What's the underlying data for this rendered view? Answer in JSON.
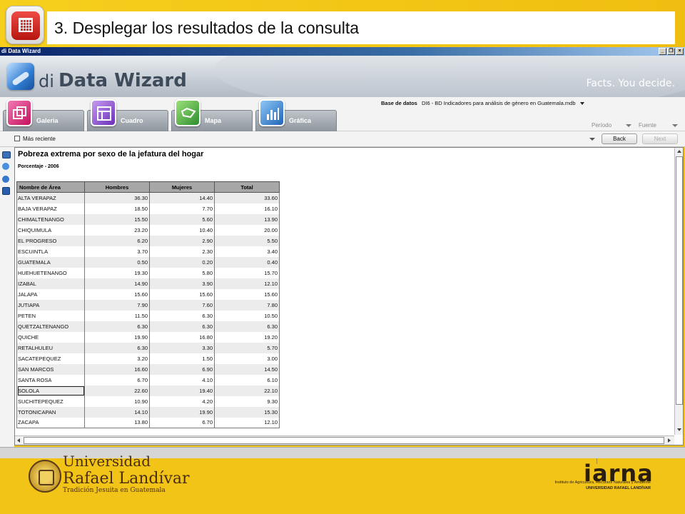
{
  "slide": {
    "title": "3. Desplegar los resultados de la consulta",
    "icon": "table-grid-icon"
  },
  "window": {
    "title": "di Data Wizard",
    "buttons": [
      "_",
      "❐",
      "×"
    ]
  },
  "app": {
    "logo_prefix": "di",
    "logo_name": "Data Wizard",
    "tagline": "Facts. You decide."
  },
  "tabs": [
    {
      "label": "Galeria",
      "icon": "gallery-icon",
      "color": "#d8287a"
    },
    {
      "label": "Cuadro",
      "icon": "table-icon",
      "color": "#7a3fc0"
    },
    {
      "label": "Mapa",
      "icon": "map-icon",
      "color": "#3aa23a"
    },
    {
      "label": "Gráfica",
      "icon": "chart-icon",
      "color": "#2a7fd0"
    }
  ],
  "database": {
    "label": "Base de datos",
    "value": "DI6 - BD Indicadores para análisis de género en Guatemala.mdb"
  },
  "filters": {
    "period": "Período",
    "source": "Fuente"
  },
  "options": {
    "checkbox_label": "Más reciente",
    "back": "Back",
    "next": "Next"
  },
  "report": {
    "title": "Pobreza extrema por sexo de la jefatura del hogar",
    "subtitle": "Porcentaje - 2006",
    "columns": [
      "Nombre de Área",
      "Hombres",
      "Mujeres",
      "Total"
    ],
    "rows": [
      [
        "ALTA VERAPAZ",
        "36.30",
        "14.40",
        "33.60"
      ],
      [
        "BAJA VERAPAZ",
        "18.50",
        "7.70",
        "16.10"
      ],
      [
        "CHIMALTENANGO",
        "15.50",
        "5.60",
        "13.90"
      ],
      [
        "CHIQUIMULA",
        "23.20",
        "10.40",
        "20.00"
      ],
      [
        "EL PROGRESO",
        "6.20",
        "2.90",
        "5.50"
      ],
      [
        "ESCUINTLA",
        "3.70",
        "2.30",
        "3.40"
      ],
      [
        "GUATEMALA",
        "0.50",
        "0.20",
        "0.40"
      ],
      [
        "HUEHUETENANGO",
        "19.30",
        "5.80",
        "15.70"
      ],
      [
        "IZABAL",
        "14.90",
        "3.90",
        "12.10"
      ],
      [
        "JALAPA",
        "15.60",
        "15.60",
        "15.60"
      ],
      [
        "JUTIAPA",
        "7.90",
        "7.60",
        "7.80"
      ],
      [
        "PETEN",
        "11.50",
        "6.30",
        "10.50"
      ],
      [
        "QUETZALTENANGO",
        "6.30",
        "6.30",
        "6.30"
      ],
      [
        "QUICHE",
        "19.90",
        "16.80",
        "19.20"
      ],
      [
        "RETALHULEU",
        "6.30",
        "3.30",
        "5.70"
      ],
      [
        "SACATEPEQUEZ",
        "3.20",
        "1.50",
        "3.00"
      ],
      [
        "SAN MARCOS",
        "16.60",
        "6.90",
        "14.50"
      ],
      [
        "SANTA ROSA",
        "6.70",
        "4.10",
        "6.10"
      ],
      [
        "SOLOLA",
        "22.60",
        "19.40",
        "22.10"
      ],
      [
        "SUCHITEPEQUEZ",
        "10.90",
        "4.20",
        "9.30"
      ],
      [
        "TOTONICAPAN",
        "14.10",
        "19.90",
        "15.30"
      ],
      [
        "ZACAPA",
        "13.80",
        "6.70",
        "12.10"
      ]
    ],
    "selected_row": 18
  },
  "footer": {
    "university_line1": "Universidad",
    "university_line2": "Rafael Landívar",
    "university_tagline": "Tradición Jesuita en Guatemala",
    "iarna_name": "iarna",
    "iarna_line1": "Instituto de Agricultura, Recursos Naturales y Ambiente",
    "iarna_line2": "UNIVERSIDAD RAFAEL LANDÍVAR"
  }
}
